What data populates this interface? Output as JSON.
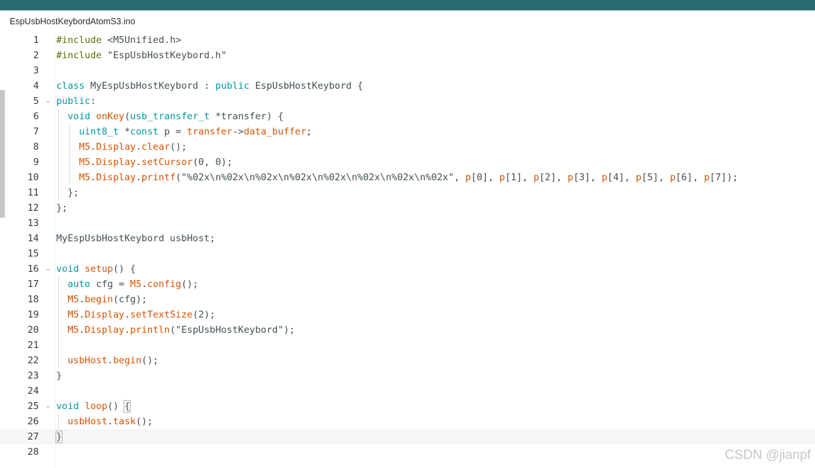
{
  "window": {
    "tab_label": "EspUsbHostKeybordAtomS3.ino",
    "accent_color": "#2b6a70"
  },
  "editor": {
    "current_line": 27,
    "lines": [
      {
        "n": "1",
        "indent": 0,
        "tokens": [
          [
            "inc",
            "#include"
          ],
          [
            "txt",
            " <M5Unified.h>"
          ]
        ]
      },
      {
        "n": "2",
        "indent": 0,
        "tokens": [
          [
            "inc",
            "#include"
          ],
          [
            "txt",
            " \"EspUsbHostKeybord.h\""
          ]
        ]
      },
      {
        "n": "3",
        "indent": 0,
        "tokens": []
      },
      {
        "n": "4",
        "indent": 0,
        "tokens": [
          [
            "kw",
            "class"
          ],
          [
            "txt",
            " MyEspUsbHostKeybord : "
          ],
          [
            "kw",
            "public"
          ],
          [
            "txt",
            " EspUsbHostKeybord {"
          ]
        ]
      },
      {
        "n": "5",
        "indent": 0,
        "fold": true,
        "tokens": [
          [
            "kw",
            "public"
          ],
          [
            "txt",
            ":"
          ]
        ]
      },
      {
        "n": "6",
        "indent": 1,
        "tokens": [
          [
            "kw",
            "void"
          ],
          [
            "txt",
            " "
          ],
          [
            "fn",
            "onKey"
          ],
          [
            "txt",
            "("
          ],
          [
            "type",
            "usb_transfer_t"
          ],
          [
            "txt",
            " *transfer) {"
          ]
        ]
      },
      {
        "n": "7",
        "indent": 2,
        "tokens": [
          [
            "type",
            "uint8_t"
          ],
          [
            "txt",
            " *"
          ],
          [
            "kw",
            "const"
          ],
          [
            "txt",
            " p = "
          ],
          [
            "obj",
            "transfer"
          ],
          [
            "txt",
            "->"
          ],
          [
            "fn",
            "data_buffer"
          ],
          [
            "txt",
            ";"
          ]
        ]
      },
      {
        "n": "8",
        "indent": 2,
        "tokens": [
          [
            "obj",
            "M5"
          ],
          [
            "txt",
            "."
          ],
          [
            "obj",
            "Display"
          ],
          [
            "txt",
            "."
          ],
          [
            "fn",
            "clear"
          ],
          [
            "txt",
            "();"
          ]
        ]
      },
      {
        "n": "9",
        "indent": 2,
        "tokens": [
          [
            "obj",
            "M5"
          ],
          [
            "txt",
            "."
          ],
          [
            "obj",
            "Display"
          ],
          [
            "txt",
            "."
          ],
          [
            "fn",
            "setCursor"
          ],
          [
            "txt",
            "(0, 0);"
          ]
        ]
      },
      {
        "n": "10",
        "indent": 2,
        "tokens": [
          [
            "obj",
            "M5"
          ],
          [
            "txt",
            "."
          ],
          [
            "obj",
            "Display"
          ],
          [
            "txt",
            "."
          ],
          [
            "fn",
            "printf"
          ],
          [
            "txt",
            "(\"%02x\\n%02x\\n%02x\\n%02x\\n%02x\\n%02x\\n%02x\\n%02x\", "
          ],
          [
            "obj",
            "p"
          ],
          [
            "txt",
            "[0], "
          ],
          [
            "obj",
            "p"
          ],
          [
            "txt",
            "[1], "
          ],
          [
            "obj",
            "p"
          ],
          [
            "txt",
            "[2], "
          ],
          [
            "obj",
            "p"
          ],
          [
            "txt",
            "[3], "
          ],
          [
            "obj",
            "p"
          ],
          [
            "txt",
            "[4], "
          ],
          [
            "obj",
            "p"
          ],
          [
            "txt",
            "[5], "
          ],
          [
            "obj",
            "p"
          ],
          [
            "txt",
            "[6], "
          ],
          [
            "obj",
            "p"
          ],
          [
            "txt",
            "[7]);"
          ]
        ]
      },
      {
        "n": "11",
        "indent": 1,
        "tokens": [
          [
            "txt",
            "};"
          ]
        ]
      },
      {
        "n": "12",
        "indent": 0,
        "tokens": [
          [
            "txt",
            "};"
          ]
        ]
      },
      {
        "n": "13",
        "indent": 0,
        "tokens": []
      },
      {
        "n": "14",
        "indent": 0,
        "tokens": [
          [
            "txt",
            "MyEspUsbHostKeybord usbHost;"
          ]
        ]
      },
      {
        "n": "15",
        "indent": 0,
        "tokens": []
      },
      {
        "n": "16",
        "indent": 0,
        "fold": true,
        "tokens": [
          [
            "kw",
            "void"
          ],
          [
            "txt",
            " "
          ],
          [
            "fn",
            "setup"
          ],
          [
            "txt",
            "() {"
          ]
        ]
      },
      {
        "n": "17",
        "indent": 1,
        "tokens": [
          [
            "kw",
            "auto"
          ],
          [
            "txt",
            " cfg = "
          ],
          [
            "obj",
            "M5"
          ],
          [
            "txt",
            "."
          ],
          [
            "fn",
            "config"
          ],
          [
            "txt",
            "();"
          ]
        ]
      },
      {
        "n": "18",
        "indent": 1,
        "tokens": [
          [
            "obj",
            "M5"
          ],
          [
            "txt",
            "."
          ],
          [
            "fn",
            "begin"
          ],
          [
            "txt",
            "(cfg);"
          ]
        ]
      },
      {
        "n": "19",
        "indent": 1,
        "tokens": [
          [
            "obj",
            "M5"
          ],
          [
            "txt",
            "."
          ],
          [
            "obj",
            "Display"
          ],
          [
            "txt",
            "."
          ],
          [
            "fn",
            "setTextSize"
          ],
          [
            "txt",
            "(2);"
          ]
        ]
      },
      {
        "n": "20",
        "indent": 1,
        "tokens": [
          [
            "obj",
            "M5"
          ],
          [
            "txt",
            "."
          ],
          [
            "obj",
            "Display"
          ],
          [
            "txt",
            "."
          ],
          [
            "fn",
            "println"
          ],
          [
            "txt",
            "(\"EspUsbHostKeybord\");"
          ]
        ]
      },
      {
        "n": "21",
        "indent": 1,
        "tokens": []
      },
      {
        "n": "22",
        "indent": 1,
        "tokens": [
          [
            "obj",
            "usbHost"
          ],
          [
            "txt",
            "."
          ],
          [
            "fn",
            "begin"
          ],
          [
            "txt",
            "();"
          ]
        ]
      },
      {
        "n": "23",
        "indent": 0,
        "tokens": [
          [
            "txt",
            "}"
          ]
        ]
      },
      {
        "n": "24",
        "indent": 0,
        "tokens": []
      },
      {
        "n": "25",
        "indent": 0,
        "fold": true,
        "tokens": [
          [
            "kw",
            "void"
          ],
          [
            "txt",
            " "
          ],
          [
            "fn",
            "loop"
          ],
          [
            "txt",
            "() "
          ],
          [
            "match",
            "{"
          ]
        ]
      },
      {
        "n": "26",
        "indent": 1,
        "tokens": [
          [
            "obj",
            "usbHost"
          ],
          [
            "txt",
            "."
          ],
          [
            "fn",
            "task"
          ],
          [
            "txt",
            "();"
          ]
        ]
      },
      {
        "n": "27",
        "indent": 0,
        "tokens": [
          [
            "match",
            "}"
          ]
        ]
      },
      {
        "n": "28",
        "indent": 0,
        "tokens": []
      }
    ]
  },
  "watermark": "CSDN @jianpf"
}
